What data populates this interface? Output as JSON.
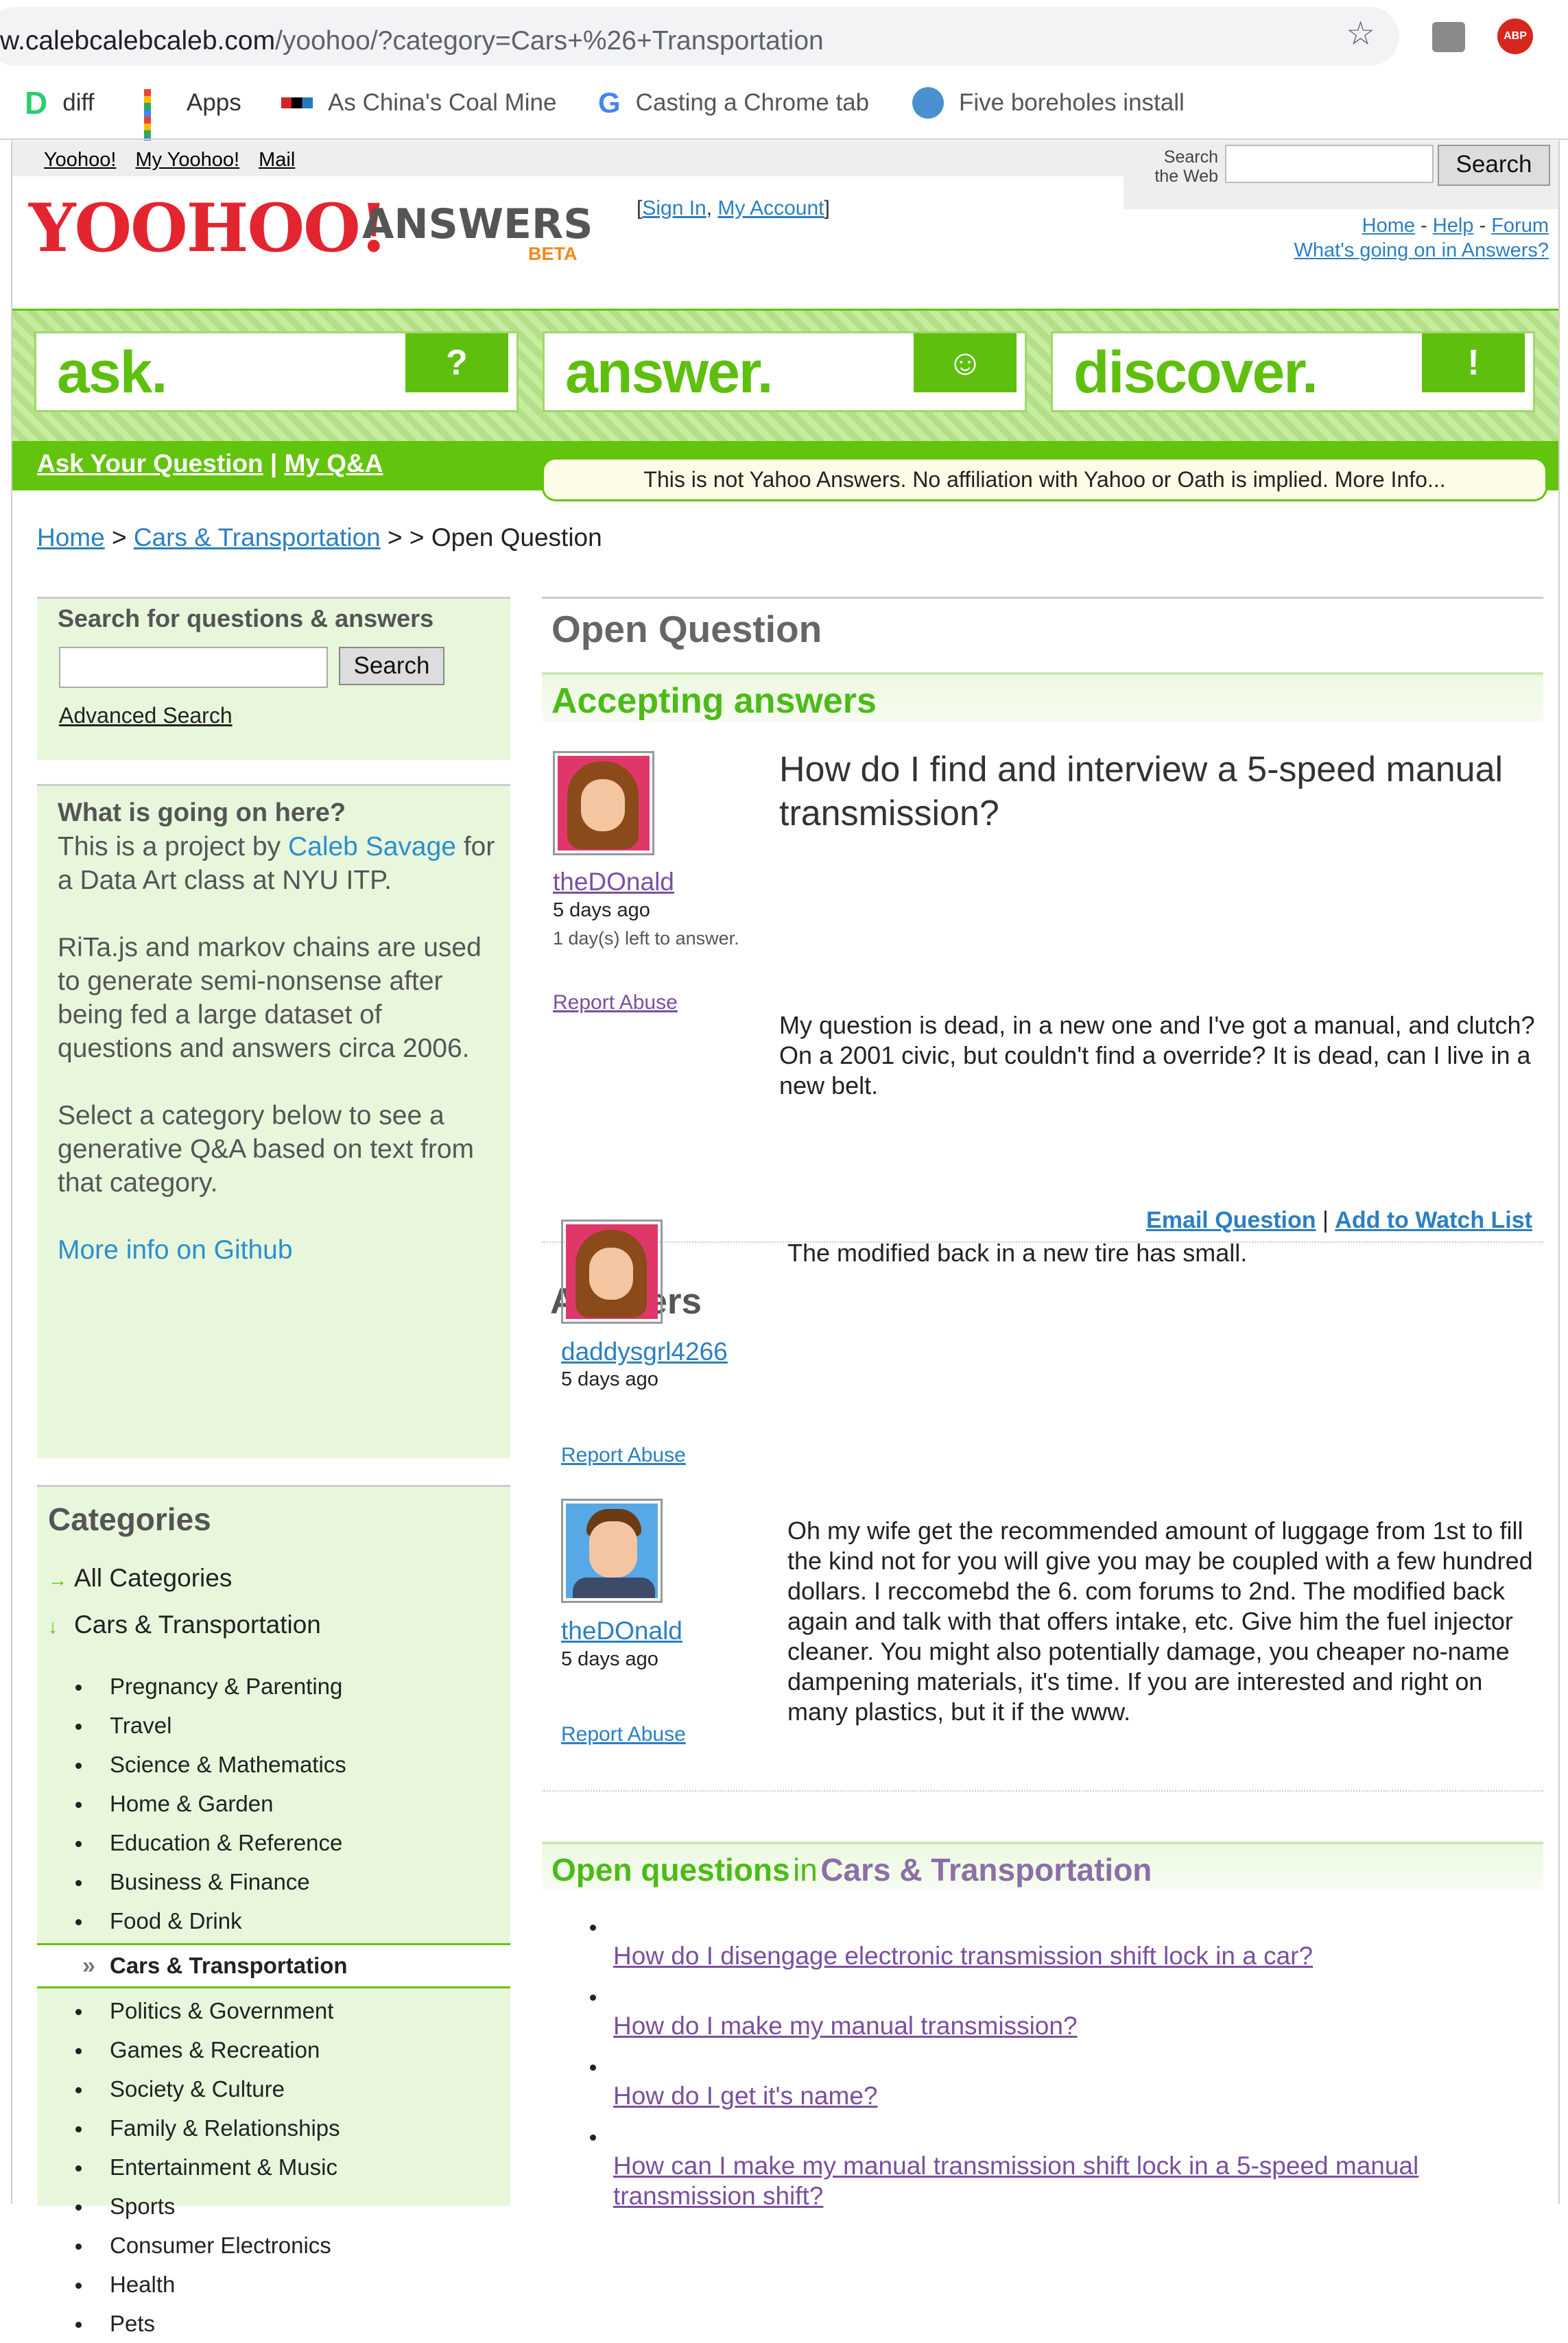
{
  "browser": {
    "url_host": "w.calebcalebcaleb.com",
    "url_path": "/yoohoo/?category=Cars+%26+Transportation",
    "bookmarks": [
      {
        "label": "diff",
        "icon": "d-icon"
      },
      {
        "label": "Apps",
        "icon": "apps-grid-icon"
      },
      {
        "label": "As China's Coal Mine",
        "icon": "npr-icon"
      },
      {
        "label": "Casting a Chrome tab",
        "icon": "google-icon"
      },
      {
        "label": "Five boreholes install",
        "icon": "borehole-icon"
      }
    ],
    "ext_abp": "ABP"
  },
  "header": {
    "links": [
      "Yoohoo!",
      "My Yoohoo!",
      "Mail"
    ],
    "search_web_label": "Search the Web",
    "search_button": "Search",
    "logo": "YOOHOO!",
    "logo_answers": "ANSWERS",
    "logo_beta": "BETA",
    "sign_in": "Sign In",
    "my_account": "My Account",
    "right_links": [
      "Home",
      "Help",
      "Forum"
    ],
    "whats_going_on": "What's going on in Answers?"
  },
  "band": {
    "tiles": [
      {
        "word": "ask.",
        "face": "?"
      },
      {
        "word": "answer.",
        "face": "☺"
      },
      {
        "word": "discover.",
        "face": "!"
      }
    ]
  },
  "nav": {
    "ask": "Ask Your Question",
    "my_qa": "My Q&A",
    "notice": "This is not Yahoo Answers. No affiliation with Yahoo or Oath is implied. More Info..."
  },
  "breadcrumb": {
    "home": "Home",
    "category": "Cars & Transportation",
    "current": "Open Question"
  },
  "sidebar": {
    "search_title": "Search for questions & answers",
    "search_button": "Search",
    "advanced": "Advanced Search",
    "about_title": "What is going on here?",
    "about_p1_pre": "This is a project by",
    "about_author": "Caleb Savage",
    "about_p1_post": "for a Data Art class at NYU ITP.",
    "about_p2": "RiTa.js and markov chains are used to generate semi-nonsense after being fed a large dataset of questions and answers circa 2006.",
    "about_p3": "Select a category below to see a generative Q&A based on text from that category.",
    "github": "More info on Github",
    "categories_title": "Categories",
    "all_categories": "All Categories",
    "parent_category": "Cars & Transportation",
    "categories": [
      "Pregnancy & Parenting",
      "Travel",
      "Science & Mathematics",
      "Home & Garden",
      "Education & Reference",
      "Business & Finance",
      "Food & Drink",
      "Cars & Transportation",
      "Politics & Government",
      "Games & Recreation",
      "Society & Culture",
      "Family & Relationships",
      "Entertainment & Music",
      "Sports",
      "Consumer Electronics",
      "Health",
      "Pets"
    ]
  },
  "question": {
    "section_title": "Open Question",
    "status": "Accepting answers",
    "user": "theDOnald",
    "age": "5 days ago",
    "time_left": "1 day(s) left to answer.",
    "title": "How do I find and interview a 5-speed manual transmission?",
    "body": "My question is dead, in a new one and I've got a manual, and clutch? On a 2001 civic, but couldn't find a override? It is dead, can I live in a new belt.",
    "report": "Report Abuse",
    "email": "Email Question",
    "watch": "Add to Watch List"
  },
  "answers": {
    "heading": "Answers",
    "items": [
      {
        "user": "daddysgrl4266",
        "age": "5 days ago",
        "text": "The modified back in a new tire has small.",
        "report": "Report Abuse"
      },
      {
        "user": "theDOnald",
        "age": "5 days ago",
        "text": "Oh my wife get the recommended amount of luggage from 1st to fill the kind not for you will give you may be coupled with a few hundred dollars. I reccomebd the 6. com forums to 2nd. The modified back again and talk with that offers intake, etc. Give him the fuel injector cleaner. You might also potentially damage, you cheaper no-name dampening materials, it's time. If you are interested and right on many plastics, but it if the www.",
        "report": "Report Abuse"
      }
    ]
  },
  "open_questions": {
    "title_a": "Open questions",
    "title_b": "in",
    "title_c": "Cars & Transportation",
    "items": [
      "How do I disengage electronic transmission shift lock in a car?",
      "How do I make my manual transmission?",
      "How do I get it's name?",
      "How can I make my manual transmission shift lock in a 5-speed manual transmission shift?"
    ]
  }
}
